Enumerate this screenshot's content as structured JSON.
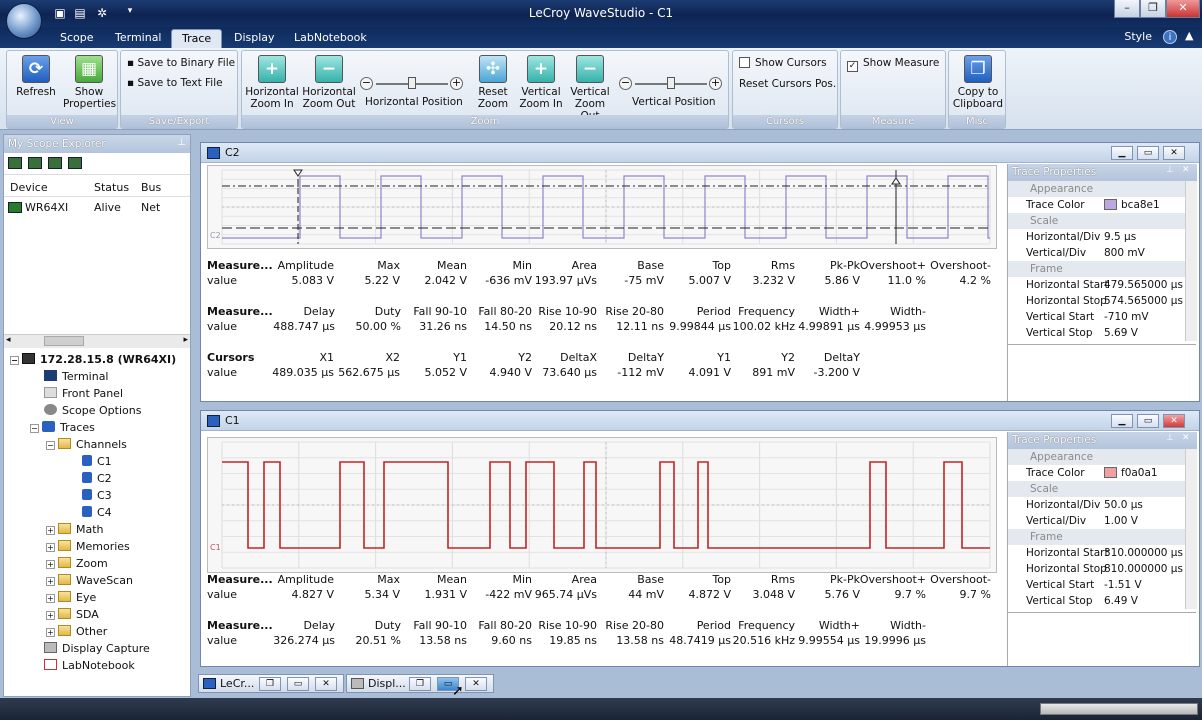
{
  "window": {
    "title": "LeCroy WaveStudio - C1",
    "controls": [
      "–",
      "❐",
      "✕"
    ]
  },
  "ribbon_tabs": [
    "Scope",
    "Terminal",
    "Trace",
    "Display",
    "LabNotebook"
  ],
  "active_tab": "Trace",
  "style_label": "Style",
  "ribbon": {
    "view": {
      "label": "View",
      "refresh": "Refresh",
      "show_properties": "Show Properties"
    },
    "save_export": {
      "label": "Save/Export",
      "binary": "Save to Binary File",
      "text": "Save to Text File"
    },
    "zoom": {
      "label": "Zoom",
      "h_zoom_in": "Horizontal Zoom In",
      "h_zoom_out": "Horizontal Zoom Out",
      "h_position": "Horizontal Position",
      "reset_zoom": "Reset Zoom",
      "v_zoom_in": "Vertical Zoom In",
      "v_zoom_out": "Vertical Zoom Out",
      "v_position": "Vertical Position"
    },
    "cursors": {
      "label": "Cursors",
      "show_cursors": "Show Cursors",
      "reset_cursors": "Reset Cursors Pos."
    },
    "measure": {
      "label": "Measure",
      "show_measure": "Show Measure"
    },
    "misc": {
      "label": "Misc",
      "copy": "Copy to Clipboard"
    }
  },
  "explorer": {
    "title": "My Scope Explorer",
    "columns": [
      "Device",
      "Status",
      "Bus"
    ],
    "device": {
      "name": "WR64XI",
      "status": "Alive",
      "bus": "Net"
    },
    "tree": {
      "root": "172.28.15.8 (WR64XI)",
      "terminal": "Terminal",
      "front_panel": "Front Panel",
      "scope_options": "Scope Options",
      "traces": "Traces",
      "channels": "Channels",
      "c1": "C1",
      "c2": "C2",
      "c3": "C3",
      "c4": "C4",
      "math": "Math",
      "memories": "Memories",
      "zoom": "Zoom",
      "wavescan": "WaveScan",
      "eye": "Eye",
      "sda": "SDA",
      "other": "Other",
      "display_capture": "Display Capture",
      "labnotebook": "LabNotebook"
    }
  },
  "c2": {
    "title": "C2",
    "trace_label": "C2",
    "meas1": {
      "label_a": "Measure...",
      "label_b": "value",
      "headers": [
        "Amplitude",
        "Max",
        "Mean",
        "Min",
        "Area",
        "Base",
        "Top",
        "Rms",
        "Pk-Pk",
        "Overshoot+",
        "Overshoot-"
      ],
      "values": [
        "5.083 V",
        "5.22 V",
        "2.042 V",
        "-636 mV",
        "193.97 µVs",
        "-75 mV",
        "5.007 V",
        "3.232 V",
        "5.86 V",
        "11.0 %",
        "4.2 %"
      ]
    },
    "meas2": {
      "label_a": "Measure...",
      "label_b": "value",
      "headers": [
        "Delay",
        "Duty",
        "Fall 90-10",
        "Fall 80-20",
        "Rise 10-90",
        "Rise 20-80",
        "Period",
        "Frequency",
        "Width+",
        "Width-"
      ],
      "values": [
        "488.747 µs",
        "50.00 %",
        "31.26 ns",
        "14.50 ns",
        "20.12 ns",
        "12.11 ns",
        "9.99844 µs",
        "100.02 kHz",
        "4.99891 µs",
        "4.99953 µs"
      ]
    },
    "cursors": {
      "label_a": "Cursors",
      "label_b": "value",
      "headers": [
        "X1",
        "X2",
        "Y1",
        "Y2",
        "DeltaX",
        "DeltaY",
        "Y1",
        "Y2",
        "DeltaY"
      ],
      "values": [
        "489.035 µs",
        "562.675 µs",
        "5.052 V",
        "4.940 V",
        "73.640 µs",
        "-112 mV",
        "4.091 V",
        "891 mV",
        "-3.200 V"
      ]
    },
    "props": {
      "title": "Trace Properties",
      "cat_appearance": "Appearance",
      "trace_color_k": "Trace Color",
      "trace_color_v": "bca8e1",
      "trace_color": "#bca8e1",
      "cat_scale": "Scale",
      "hdiv_k": "Horizontal/Div",
      "hdiv_v": "9.5 µs",
      "vdiv_k": "Vertical/Div",
      "vdiv_v": "800 mV",
      "cat_frame": "Frame",
      "hstart_k": "Horizontal Start",
      "hstart_v": "479.565000 µs",
      "hstop_k": "Horizontal Stop",
      "hstop_v": "574.565000 µs",
      "vstart_k": "Vertical Start",
      "vstart_v": "-710 mV",
      "vstop_k": "Vertical Stop",
      "vstop_v": "5.69 V"
    }
  },
  "c1": {
    "title": "C1",
    "trace_label": "C1",
    "meas1": {
      "label_a": "Measure...",
      "label_b": "value",
      "headers": [
        "Amplitude",
        "Max",
        "Mean",
        "Min",
        "Area",
        "Base",
        "Top",
        "Rms",
        "Pk-Pk",
        "Overshoot+",
        "Overshoot-"
      ],
      "values": [
        "4.827 V",
        "5.34 V",
        "1.931 V",
        "-422 mV",
        "965.74 µVs",
        "44 mV",
        "4.872 V",
        "3.048 V",
        "5.76 V",
        "9.7 %",
        "9.7 %"
      ]
    },
    "meas2": {
      "label_a": "Measure...",
      "label_b": "value",
      "headers": [
        "Delay",
        "Duty",
        "Fall 90-10",
        "Fall 80-20",
        "Rise 10-90",
        "Rise 20-80",
        "Period",
        "Frequency",
        "Width+",
        "Width-"
      ],
      "values": [
        "326.274 µs",
        "20.51 %",
        "13.58 ns",
        "9.60 ns",
        "19.85 ns",
        "13.58 ns",
        "48.7419 µs",
        "20.516 kHz",
        "9.99554 µs",
        "19.9996 µs"
      ]
    },
    "props": {
      "title": "Trace Properties",
      "cat_appearance": "Appearance",
      "trace_color_k": "Trace Color",
      "trace_color_v": "f0a0a1",
      "trace_color": "#f0a0a1",
      "cat_scale": "Scale",
      "hdiv_k": "Horizontal/Div",
      "hdiv_v": "50.0 µs",
      "vdiv_k": "Vertical/Div",
      "vdiv_v": "1.00 V",
      "cat_frame": "Frame",
      "hstart_k": "Horizontal Start",
      "hstart_v": "310.000000 µs",
      "hstop_k": "Horizontal Stop",
      "hstop_v": "810.000000 µs",
      "vstart_k": "Vertical Start",
      "vstart_v": "-1.51 V",
      "vstop_k": "Vertical Stop",
      "vstop_v": "6.49 V"
    }
  },
  "taskbar": {
    "item1": "LeCr...",
    "item2": "Displ..."
  },
  "colors": {
    "c2_wave": "#8f86c9",
    "c1_wave": "#c42525"
  }
}
